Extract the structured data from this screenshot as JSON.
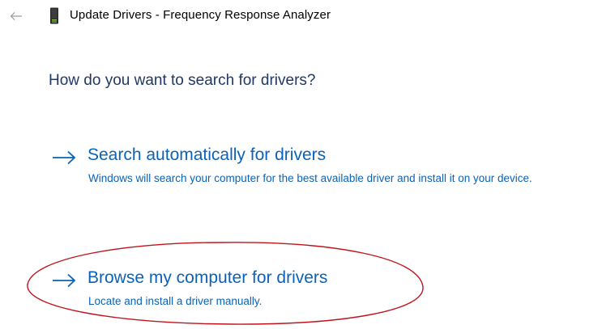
{
  "window": {
    "title": "Update Drivers - Frequency Response Analyzer",
    "back_icon": "back-arrow-icon",
    "device_icon": "device-icon"
  },
  "heading": "How do you want to search for drivers?",
  "options": [
    {
      "icon": "arrow-right-icon",
      "title": "Search automatically for drivers",
      "description": "Windows will search your computer for the best available driver and install it on your device."
    },
    {
      "icon": "arrow-right-icon",
      "title": "Browse my computer for drivers",
      "description": "Locate and install a driver manually."
    }
  ],
  "colors": {
    "link": "#0a63b8",
    "heading": "#1f3864",
    "annotation": "#c0141c"
  }
}
